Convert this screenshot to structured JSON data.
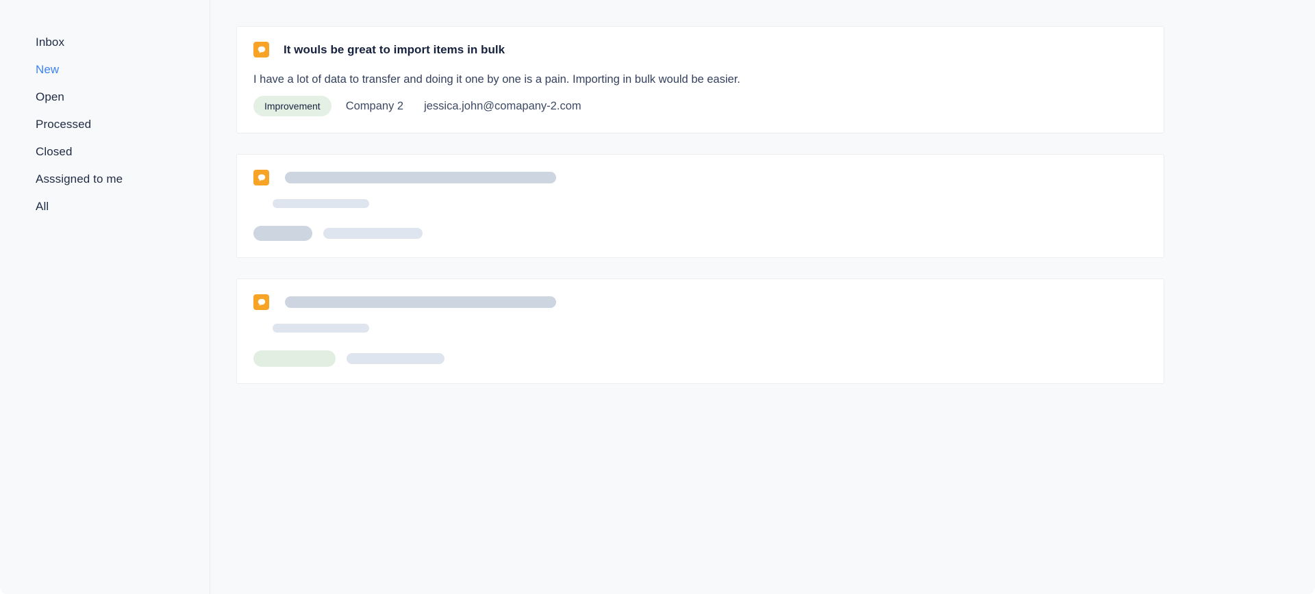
{
  "sidebar": {
    "items": [
      {
        "label": "Inbox",
        "active": false
      },
      {
        "label": "New",
        "active": true
      },
      {
        "label": "Open",
        "active": false
      },
      {
        "label": "Processed",
        "active": false
      },
      {
        "label": "Closed",
        "active": false
      },
      {
        "label": "Asssigned to me",
        "active": false
      },
      {
        "label": "All",
        "active": false
      }
    ],
    "active_color": "#3B82F6",
    "text_color": "#1F2A44"
  },
  "main": {
    "cards": [
      {
        "icon": "chat-bubble-icon",
        "icon_color": "#F7A325",
        "title": "It wouls be great to import items in bulk",
        "body": "I have a lot of data to transfer and doing it one by one is a pain. Importing in bulk would be easier.",
        "badge": "Improvement",
        "badge_color": "#E5F0E4",
        "company": "Company 2",
        "email": "jessica.john@comapany-2.com",
        "loading": false
      },
      {
        "icon": "chat-bubble-icon",
        "icon_color": "#F7A325",
        "title": "",
        "body": "",
        "badge": "",
        "badge_color": "#CDD5E0",
        "company": "",
        "email": "",
        "loading": true
      },
      {
        "icon": "chat-bubble-icon",
        "icon_color": "#F7A325",
        "title": "",
        "body": "",
        "badge": "",
        "badge_color": "#E3EEE2",
        "company": "",
        "email": "",
        "loading": true
      }
    ]
  }
}
